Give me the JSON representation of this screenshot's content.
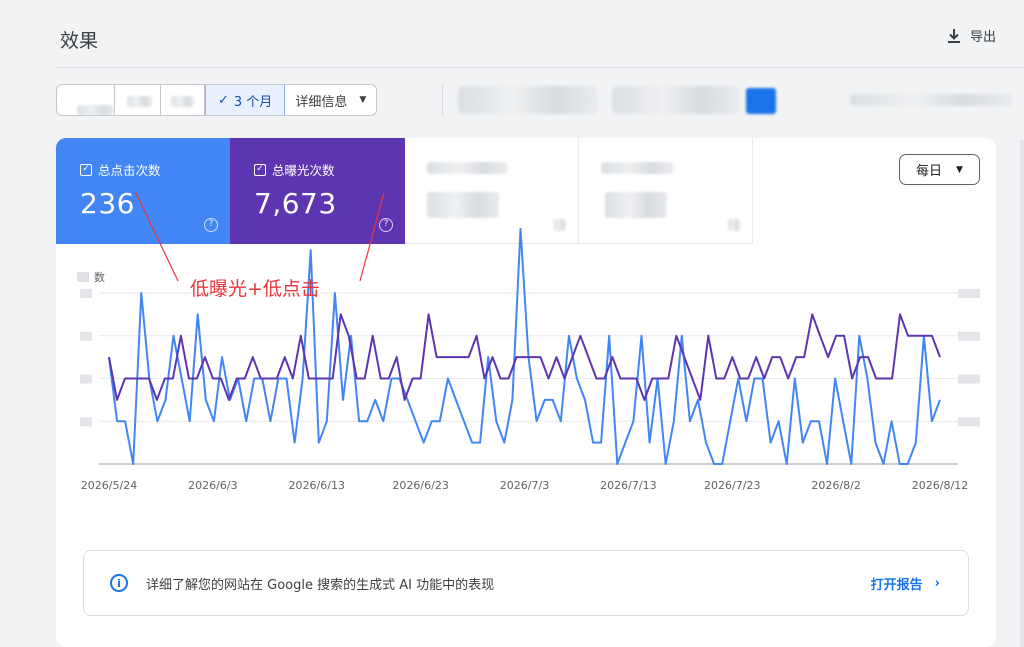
{
  "header": {
    "title": "效果",
    "export_label": "导出"
  },
  "filters": {
    "date_range_selected": "3 个月",
    "more_label": "详细信息"
  },
  "metrics": {
    "clicks": {
      "label": "总点击次数",
      "value": "236"
    },
    "impressions": {
      "label": "总曝光次数",
      "value": "7,673"
    }
  },
  "granularity": "每日",
  "chart_data": {
    "type": "line",
    "x_tick_labels": [
      "2026/5/24",
      "2026/6/3",
      "2026/6/13",
      "2026/6/23",
      "2026/7/3",
      "2026/7/13",
      "2026/7/23",
      "2026/8/2",
      "2026/8/12"
    ],
    "left_axis_partial_label": "数",
    "annotation": "低曝光+低点击",
    "ylim": [
      0,
      8
    ],
    "grid": true,
    "series": [
      {
        "color": "#4285f4",
        "values": [
          5,
          2,
          2,
          0,
          8,
          4,
          2,
          3,
          6,
          4,
          2,
          7,
          3,
          2,
          5,
          3,
          4,
          2,
          4,
          4,
          2,
          4,
          4,
          1,
          4,
          10,
          1,
          2,
          8,
          3,
          6,
          2,
          2,
          3,
          2,
          4,
          4,
          3,
          2,
          1,
          2,
          2,
          4,
          3,
          2,
          1,
          1,
          5,
          2,
          1,
          3,
          11,
          5,
          2,
          3,
          3,
          2,
          6,
          4,
          3,
          1,
          1,
          6,
          0,
          1,
          2,
          6,
          1,
          4,
          0,
          2,
          6,
          2,
          3,
          1,
          0,
          0,
          2,
          4,
          2,
          4,
          4,
          1,
          2,
          0,
          4,
          1,
          2,
          2,
          0,
          4,
          2,
          0,
          6,
          4,
          1,
          0,
          2,
          0,
          0,
          1,
          6,
          2,
          3
        ]
      },
      {
        "color": "#5e35b1",
        "values": [
          5,
          3,
          4,
          4,
          4,
          4,
          3,
          4,
          4,
          6,
          4,
          4,
          5,
          4,
          4,
          3,
          4,
          4,
          5,
          4,
          4,
          4,
          5,
          4,
          6,
          4,
          4,
          4,
          4,
          7,
          6,
          4,
          4,
          6,
          4,
          4,
          5,
          3,
          4,
          4,
          7,
          5,
          5,
          5,
          5,
          5,
          6,
          4,
          5,
          4,
          4,
          5,
          5,
          5,
          5,
          4,
          5,
          4,
          5,
          6,
          5,
          4,
          4,
          5,
          4,
          4,
          4,
          3,
          4,
          4,
          4,
          6,
          5,
          4,
          3,
          6,
          4,
          4,
          5,
          4,
          4,
          5,
          4,
          5,
          5,
          4,
          5,
          5,
          7,
          6,
          5,
          6,
          6,
          4,
          5,
          5,
          4,
          4,
          4,
          7,
          6,
          6,
          6,
          6,
          5
        ]
      }
    ]
  },
  "banner": {
    "text": "详细了解您的网站在 Google 搜索的生成式 AI 功能中的表现",
    "link_label": "打开报告"
  },
  "icons": {
    "export": "download-icon",
    "check": "check-icon",
    "dropdown": "caret-down-icon",
    "help": "help-circle-icon",
    "info": "info-icon",
    "chevron": "chevron-right-icon"
  }
}
